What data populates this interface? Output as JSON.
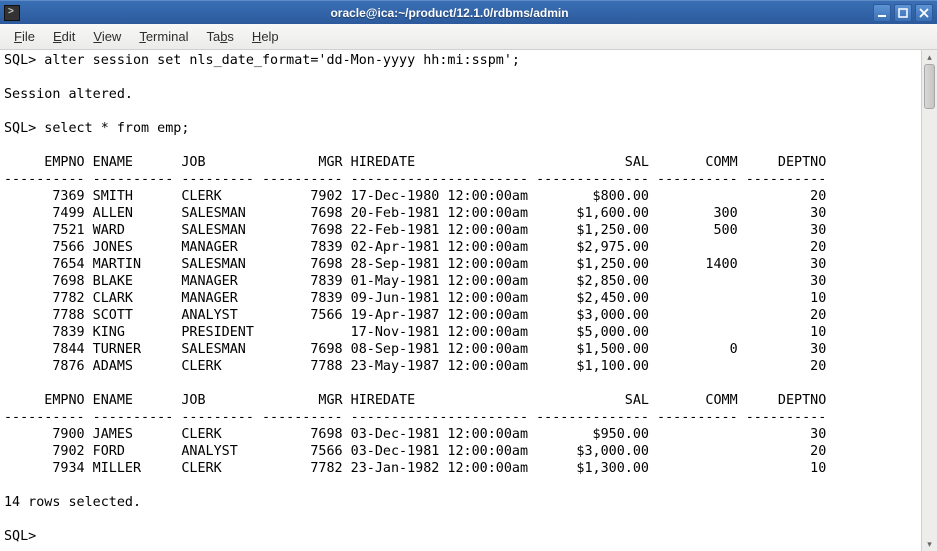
{
  "window": {
    "title": "oracle@ica:~/product/12.1.0/rdbms/admin"
  },
  "menubar": {
    "file": "File",
    "edit": "Edit",
    "view": "View",
    "terminal": "Terminal",
    "tabs": "Tabs",
    "help": "Help"
  },
  "terminal": {
    "prompt": "SQL>",
    "cmd1": "alter session set nls_date_format='dd-Mon-yyyy hh:mi:sspm';",
    "resp1": "Session altered.",
    "cmd2": "select * from emp;",
    "headers": {
      "empno": "EMPNO",
      "ename": "ENAME",
      "job": "JOB",
      "mgr": "MGR",
      "hiredate": "HIREDATE",
      "sal": "SAL",
      "comm": "COMM",
      "deptno": "DEPTNO"
    },
    "rows_part1": [
      {
        "empno": "7369",
        "ename": "SMITH",
        "job": "CLERK",
        "mgr": "7902",
        "hiredate": "17-Dec-1980 12:00:00am",
        "sal": "$800.00",
        "comm": "",
        "deptno": "20"
      },
      {
        "empno": "7499",
        "ename": "ALLEN",
        "job": "SALESMAN",
        "mgr": "7698",
        "hiredate": "20-Feb-1981 12:00:00am",
        "sal": "$1,600.00",
        "comm": "300",
        "deptno": "30"
      },
      {
        "empno": "7521",
        "ename": "WARD",
        "job": "SALESMAN",
        "mgr": "7698",
        "hiredate": "22-Feb-1981 12:00:00am",
        "sal": "$1,250.00",
        "comm": "500",
        "deptno": "30"
      },
      {
        "empno": "7566",
        "ename": "JONES",
        "job": "MANAGER",
        "mgr": "7839",
        "hiredate": "02-Apr-1981 12:00:00am",
        "sal": "$2,975.00",
        "comm": "",
        "deptno": "20"
      },
      {
        "empno": "7654",
        "ename": "MARTIN",
        "job": "SALESMAN",
        "mgr": "7698",
        "hiredate": "28-Sep-1981 12:00:00am",
        "sal": "$1,250.00",
        "comm": "1400",
        "deptno": "30"
      },
      {
        "empno": "7698",
        "ename": "BLAKE",
        "job": "MANAGER",
        "mgr": "7839",
        "hiredate": "01-May-1981 12:00:00am",
        "sal": "$2,850.00",
        "comm": "",
        "deptno": "30"
      },
      {
        "empno": "7782",
        "ename": "CLARK",
        "job": "MANAGER",
        "mgr": "7839",
        "hiredate": "09-Jun-1981 12:00:00am",
        "sal": "$2,450.00",
        "comm": "",
        "deptno": "10"
      },
      {
        "empno": "7788",
        "ename": "SCOTT",
        "job": "ANALYST",
        "mgr": "7566",
        "hiredate": "19-Apr-1987 12:00:00am",
        "sal": "$3,000.00",
        "comm": "",
        "deptno": "20"
      },
      {
        "empno": "7839",
        "ename": "KING",
        "job": "PRESIDENT",
        "mgr": "",
        "hiredate": "17-Nov-1981 12:00:00am",
        "sal": "$5,000.00",
        "comm": "",
        "deptno": "10"
      },
      {
        "empno": "7844",
        "ename": "TURNER",
        "job": "SALESMAN",
        "mgr": "7698",
        "hiredate": "08-Sep-1981 12:00:00am",
        "sal": "$1,500.00",
        "comm": "0",
        "deptno": "30"
      },
      {
        "empno": "7876",
        "ename": "ADAMS",
        "job": "CLERK",
        "mgr": "7788",
        "hiredate": "23-May-1987 12:00:00am",
        "sal": "$1,100.00",
        "comm": "",
        "deptno": "20"
      }
    ],
    "rows_part2": [
      {
        "empno": "7900",
        "ename": "JAMES",
        "job": "CLERK",
        "mgr": "7698",
        "hiredate": "03-Dec-1981 12:00:00am",
        "sal": "$950.00",
        "comm": "",
        "deptno": "30"
      },
      {
        "empno": "7902",
        "ename": "FORD",
        "job": "ANALYST",
        "mgr": "7566",
        "hiredate": "03-Dec-1981 12:00:00am",
        "sal": "$3,000.00",
        "comm": "",
        "deptno": "20"
      },
      {
        "empno": "7934",
        "ename": "MILLER",
        "job": "CLERK",
        "mgr": "7782",
        "hiredate": "23-Jan-1982 12:00:00am",
        "sal": "$1,300.00",
        "comm": "",
        "deptno": "10"
      }
    ],
    "footer": "14 rows selected.",
    "separator": "---------- ---------- --------- ---------- ---------------------- -------------- ---------- ----------"
  }
}
